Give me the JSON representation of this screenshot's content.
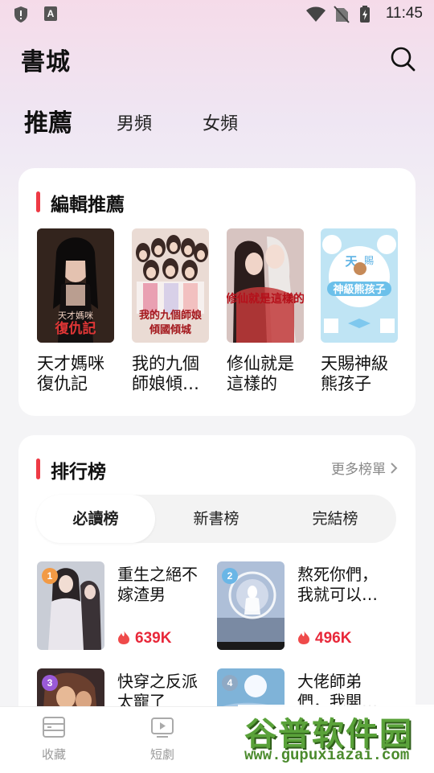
{
  "status": {
    "time": "11:45"
  },
  "header": {
    "title": "書城"
  },
  "tabs": [
    {
      "label": "推薦",
      "active": true
    },
    {
      "label": "男頻",
      "active": false
    },
    {
      "label": "女頻",
      "active": false
    }
  ],
  "editor_picks": {
    "title": "編輯推薦",
    "books": [
      {
        "title": "天才媽咪復仇記",
        "cover_text": "天才媽咪復仇記"
      },
      {
        "title": "我的九個師娘傾…",
        "cover_text": "我的九個師娘傾國傾城"
      },
      {
        "title": "修仙就是這樣的",
        "cover_text": "修仙就是這樣的"
      },
      {
        "title": "天賜神級熊孩子",
        "cover_text": "天賜神級熊孩子"
      }
    ]
  },
  "ranking": {
    "title": "排行榜",
    "more": "更多榜單",
    "segments": [
      {
        "label": "必讀榜",
        "active": true
      },
      {
        "label": "新書榜",
        "active": false
      },
      {
        "label": "完結榜",
        "active": false
      }
    ],
    "items": [
      {
        "rank": "1",
        "title": "重生之絕不嫁渣男",
        "heat": "639K"
      },
      {
        "rank": "2",
        "title": "熬死你們，我就可以…",
        "heat": "496K"
      },
      {
        "rank": "3",
        "title": "快穿之反派太寵了",
        "heat": ""
      },
      {
        "rank": "4",
        "title": "大佬師弟們，我開…",
        "heat": ""
      }
    ]
  },
  "bottom_nav": [
    {
      "label": "收藏",
      "icon": "bookshelf-icon"
    },
    {
      "label": "短劇",
      "icon": "video-icon"
    }
  ],
  "watermark": {
    "text": "谷普软件园",
    "url": "www.gupuxiazai.com"
  },
  "colors": {
    "accent": "#ee3a45",
    "heat": "#e8283a"
  }
}
